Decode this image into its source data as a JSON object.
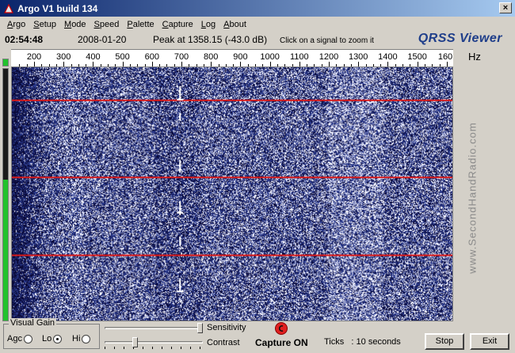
{
  "window": {
    "title": "Argo V1 build 134",
    "close_symbol": "×"
  },
  "menu": [
    "Argo",
    "Setup",
    "Mode",
    "Speed",
    "Palette",
    "Capture",
    "Log",
    "About"
  ],
  "info": {
    "time": "02:54:48",
    "date": "2008-01-20",
    "peak": "Peak at 1358.15 (-43.0 dB)",
    "hint": "Click on a signal to zoom it",
    "brand": "QRSS Viewer",
    "unit": "Hz"
  },
  "scale": {
    "labels": [
      "200",
      "300",
      "400",
      "500",
      "600",
      "700",
      "800",
      "900",
      "1000",
      "1100",
      "1200",
      "1300",
      "1400",
      "1500",
      "160"
    ]
  },
  "spectrum": {
    "colors": {
      "dark": "#0a0a3a",
      "mid": "#2b3a8c",
      "light": "#eef0ff",
      "marker_line": "#d81a1a"
    }
  },
  "watermark": "www.SecondHandRadio.com",
  "visual_gain": {
    "title": "Visual Gain",
    "options": [
      {
        "label": "Agc",
        "selected": false
      },
      {
        "label": "Lo",
        "selected": true
      },
      {
        "label": "Hi",
        "selected": false
      }
    ]
  },
  "controls": {
    "sensitivity_label": "Sensitivity",
    "contrast_label": "Contrast",
    "sensitivity_level": 1.0,
    "contrast_level": 0.3,
    "capture_status": "Capture ON",
    "ticks_text": "Ticks   : 10 seconds",
    "stop_label": "Stop",
    "exit_label": "Exit"
  }
}
